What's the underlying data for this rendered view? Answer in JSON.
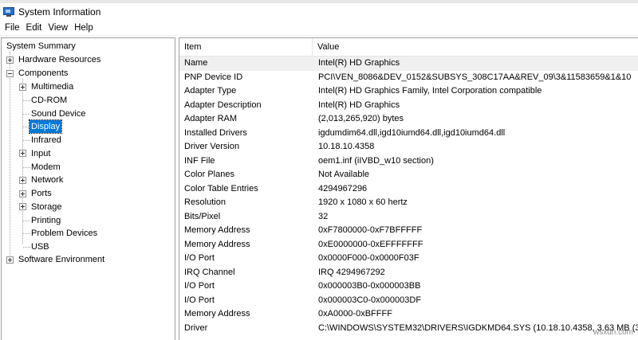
{
  "window": {
    "title": "System Information"
  },
  "menu": {
    "file": "File",
    "edit": "Edit",
    "view": "View",
    "help": "Help"
  },
  "tree": {
    "root": "System Summary",
    "hardware_resources": "Hardware Resources",
    "components": "Components",
    "children": [
      {
        "label": "Multimedia",
        "expandable": true,
        "selected": false
      },
      {
        "label": "CD-ROM",
        "expandable": false,
        "selected": false
      },
      {
        "label": "Sound Device",
        "expandable": false,
        "selected": false
      },
      {
        "label": "Display",
        "expandable": false,
        "selected": true
      },
      {
        "label": "Infrared",
        "expandable": false,
        "selected": false
      },
      {
        "label": "Input",
        "expandable": true,
        "selected": false
      },
      {
        "label": "Modem",
        "expandable": false,
        "selected": false
      },
      {
        "label": "Network",
        "expandable": true,
        "selected": false
      },
      {
        "label": "Ports",
        "expandable": true,
        "selected": false
      },
      {
        "label": "Storage",
        "expandable": true,
        "selected": false
      },
      {
        "label": "Printing",
        "expandable": false,
        "selected": false
      },
      {
        "label": "Problem Devices",
        "expandable": false,
        "selected": false
      },
      {
        "label": "USB",
        "expandable": false,
        "selected": false
      }
    ],
    "software_environment": "Software Environment"
  },
  "table": {
    "headers": {
      "item": "Item",
      "value": "Value"
    },
    "rows": [
      {
        "item": "Name",
        "value": "Intel(R) HD Graphics"
      },
      {
        "item": "PNP Device ID",
        "value": "PCI\\VEN_8086&DEV_0152&SUBSYS_308C17AA&REV_09\\3&11583659&1&10"
      },
      {
        "item": "Adapter Type",
        "value": "Intel(R) HD Graphics Family, Intel Corporation compatible"
      },
      {
        "item": "Adapter Description",
        "value": "Intel(R) HD Graphics"
      },
      {
        "item": "Adapter RAM",
        "value": "(2,013,265,920) bytes"
      },
      {
        "item": "Installed Drivers",
        "value": "igdumdim64.dll,igd10iumd64.dll,igd10iumd64.dll"
      },
      {
        "item": "Driver Version",
        "value": "10.18.10.4358"
      },
      {
        "item": "INF File",
        "value": "oem1.inf (iIVBD_w10 section)"
      },
      {
        "item": "Color Planes",
        "value": "Not Available"
      },
      {
        "item": "Color Table Entries",
        "value": "4294967296"
      },
      {
        "item": "Resolution",
        "value": "1920 x 1080 x 60 hertz"
      },
      {
        "item": "Bits/Pixel",
        "value": "32"
      },
      {
        "item": "Memory Address",
        "value": "0xF7800000-0xF7BFFFFF"
      },
      {
        "item": "Memory Address",
        "value": "0xE0000000-0xEFFFFFFF"
      },
      {
        "item": "I/O Port",
        "value": "0x0000F000-0x0000F03F"
      },
      {
        "item": "IRQ Channel",
        "value": "IRQ 4294967292"
      },
      {
        "item": "I/O Port",
        "value": "0x000003B0-0x000003BB"
      },
      {
        "item": "I/O Port",
        "value": "0x000003C0-0x000003DF"
      },
      {
        "item": "Memory Address",
        "value": "0xA0000-0xBFFFF"
      },
      {
        "item": "Driver",
        "value": "C:\\WINDOWS\\SYSTEM32\\DRIVERS\\IGDKMD64.SYS (10.18.10.4358, 3.63 MB (3..."
      }
    ]
  },
  "watermark": "wsxdn.com"
}
